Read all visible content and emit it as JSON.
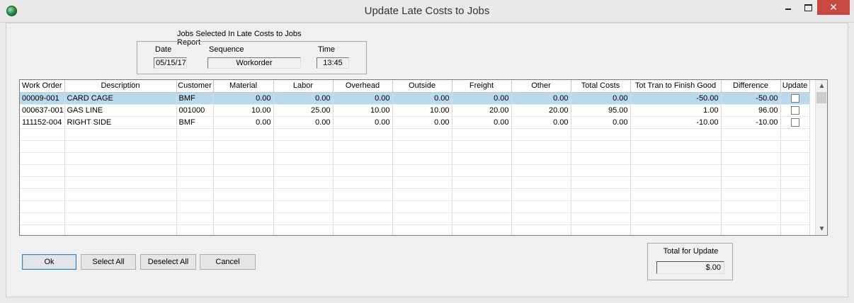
{
  "window": {
    "title": "Update Late Costs to Jobs",
    "close_glyph": "✕",
    "icon": "app-globe-icon"
  },
  "selection_group": {
    "title": "Jobs Selected In Late Costs to Jobs Report",
    "date_label": "Date",
    "date_value": "05/15/17",
    "sequence_label": "Sequence",
    "sequence_value": "Workorder",
    "time_label": "Time",
    "time_value": "13:45"
  },
  "grid": {
    "columns": [
      "Work Order",
      "Description",
      "Customer",
      "Material",
      "Labor",
      "Overhead",
      "Outside",
      "Freight",
      "Other",
      "Total Costs",
      "Tot Tran to Finish Good",
      "Difference",
      "Update"
    ],
    "rows": [
      {
        "work_order": "00009-001",
        "description": "CARD CAGE",
        "customer": "BMF",
        "material": "0.00",
        "labor": "0.00",
        "overhead": "0.00",
        "outside": "0.00",
        "freight": "0.00",
        "other": "0.00",
        "total_costs": "0.00",
        "tot_tran": "-50.00",
        "difference": "-50.00",
        "update": false,
        "selected": true
      },
      {
        "work_order": "000637-001",
        "description": "GAS LINE",
        "customer": "001000",
        "material": "10.00",
        "labor": "25.00",
        "overhead": "10.00",
        "outside": "10.00",
        "freight": "20.00",
        "other": "20.00",
        "total_costs": "95.00",
        "tot_tran": "1.00",
        "difference": "96.00",
        "update": false,
        "selected": false
      },
      {
        "work_order": "111152-004",
        "description": "RIGHT SIDE",
        "customer": "BMF",
        "material": "0.00",
        "labor": "0.00",
        "overhead": "0.00",
        "outside": "0.00",
        "freight": "0.00",
        "other": "0.00",
        "total_costs": "0.00",
        "tot_tran": "-10.00",
        "difference": "-10.00",
        "update": false,
        "selected": false
      }
    ],
    "empty_rows": 9,
    "scroll_up_glyph": "▲",
    "scroll_down_glyph": "▼"
  },
  "buttons": {
    "ok": "Ok",
    "select_all": "Select All",
    "deselect_all": "Deselect All",
    "cancel": "Cancel"
  },
  "total": {
    "label": "Total for Update",
    "value": "$.00"
  },
  "colors": {
    "selected_row": "#b9d9ec",
    "close_button": "#c74a42"
  }
}
